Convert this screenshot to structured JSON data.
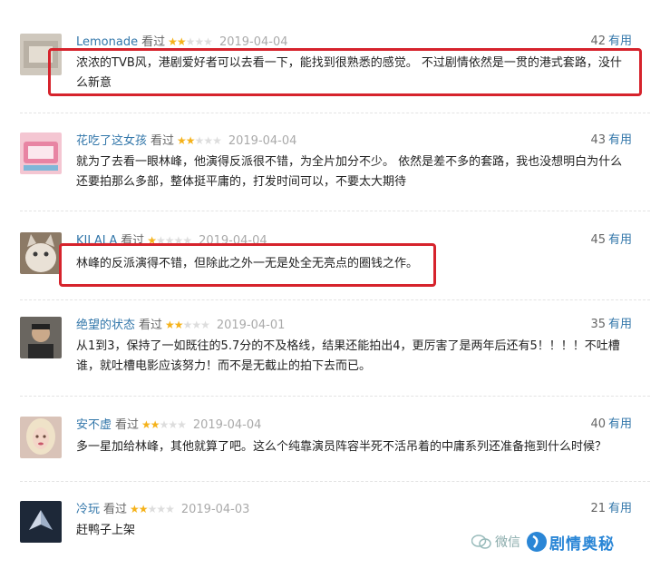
{
  "reviews": [
    {
      "username": "Lemonade",
      "watched": "看过",
      "stars": 2,
      "date": "2019-04-04",
      "useful_count": "42",
      "useful_label": "有用",
      "text": "浓浓的TVB风，港剧爱好者可以去看一下，能找到很熟悉的感觉。 不过剧情依然是一贯的港式套路，没什么新意",
      "avatar_color": "#c9c2b6"
    },
    {
      "username": "花吃了这女孩",
      "watched": "看过",
      "stars": 2,
      "date": "2019-04-04",
      "useful_count": "43",
      "useful_label": "有用",
      "text": "就为了去看一眼林峰，他演得反派很不错，为全片加分不少。 依然是差不多的套路，我也没想明白为什么还要拍那么多部，整体挺平庸的，打发时间可以，不要太大期待",
      "avatar_color": "#e88fa8"
    },
    {
      "username": "KILALA",
      "watched": "看过",
      "stars": 1,
      "date": "2019-04-04",
      "useful_count": "45",
      "useful_label": "有用",
      "text": "林峰的反派演得不错，但除此之外一无是处全无亮点的圈钱之作。",
      "avatar_color": "#b7a48c"
    },
    {
      "username": "绝望的状态",
      "watched": "看过",
      "stars": 2,
      "date": "2019-04-01",
      "useful_count": "35",
      "useful_label": "有用",
      "text": "从1到3，保持了一如既往的5.7分的不及格线，结果还能拍出4，更厉害了是两年后还有5！！！！不吐槽谁，就吐槽电影应该努力！而不是无截止的拍下去而已。",
      "avatar_color": "#4a4a44"
    },
    {
      "username": "安不虚",
      "watched": "看过",
      "stars": 2,
      "date": "2019-04-04",
      "useful_count": "40",
      "useful_label": "有用",
      "text": "多一星加给林峰，其他就算了吧。这么个纯靠演员阵容半死不活吊着的中庸系列还准备拖到什么时候？",
      "avatar_color": "#d7b7a6"
    },
    {
      "username": "冷玩",
      "watched": "看过",
      "stars": 2,
      "date": "2019-04-03",
      "useful_count": "21",
      "useful_label": "有用",
      "text": "赶鸭子上架",
      "avatar_color": "#1e2a3c"
    }
  ],
  "watermark": {
    "wechat": "微信",
    "name": "剧情奥秘"
  },
  "colors": {
    "link": "#3377aa",
    "star": "#f5b21a",
    "highlight": "#d6232c"
  }
}
